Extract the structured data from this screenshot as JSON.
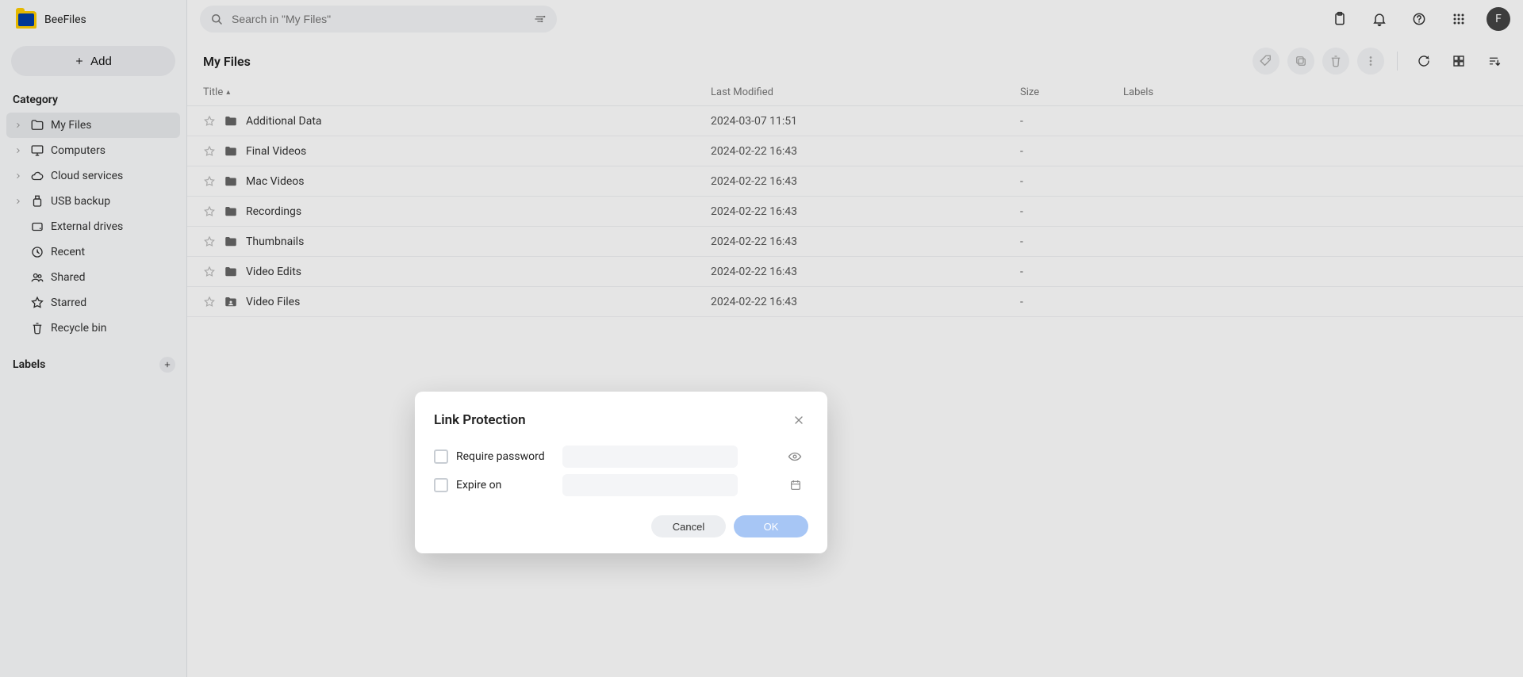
{
  "brand": {
    "name": "BeeFiles"
  },
  "sidebar": {
    "add_label": "Add",
    "category_title": "Category",
    "items": [
      {
        "label": "My Files",
        "icon": "folder-icon",
        "expandable": true,
        "active": true
      },
      {
        "label": "Computers",
        "icon": "monitor-icon",
        "expandable": true,
        "active": false
      },
      {
        "label": "Cloud services",
        "icon": "cloud-icon",
        "expandable": true,
        "active": false
      },
      {
        "label": "USB backup",
        "icon": "usb-icon",
        "expandable": true,
        "active": false
      },
      {
        "label": "External drives",
        "icon": "hdd-icon",
        "expandable": false,
        "active": false
      },
      {
        "label": "Recent",
        "icon": "clock-icon",
        "expandable": false,
        "active": false
      },
      {
        "label": "Shared",
        "icon": "people-icon",
        "expandable": false,
        "active": false
      },
      {
        "label": "Starred",
        "icon": "star-icon",
        "expandable": false,
        "active": false
      },
      {
        "label": "Recycle bin",
        "icon": "trash-icon",
        "expandable": false,
        "active": false
      }
    ],
    "labels_title": "Labels"
  },
  "search": {
    "placeholder": "Search in \"My Files\""
  },
  "avatar_initial": "F",
  "page_title": "My Files",
  "columns": {
    "title": "Title",
    "last_modified": "Last Modified",
    "size": "Size",
    "labels": "Labels"
  },
  "files": [
    {
      "name": "Additional Data",
      "modified": "2024-03-07 11:51",
      "size": "-",
      "icon": "folder"
    },
    {
      "name": "Final Videos",
      "modified": "2024-02-22 16:43",
      "size": "-",
      "icon": "folder"
    },
    {
      "name": "Mac Videos",
      "modified": "2024-02-22 16:43",
      "size": "-",
      "icon": "folder"
    },
    {
      "name": "Recordings",
      "modified": "2024-02-22 16:43",
      "size": "-",
      "icon": "folder"
    },
    {
      "name": "Thumbnails",
      "modified": "2024-02-22 16:43",
      "size": "-",
      "icon": "folder"
    },
    {
      "name": "Video Edits",
      "modified": "2024-02-22 16:43",
      "size": "-",
      "icon": "folder"
    },
    {
      "name": "Video Files",
      "modified": "2024-02-22 16:43",
      "size": "-",
      "icon": "folder-person"
    }
  ],
  "modal": {
    "title": "Link Protection",
    "require_password_label": "Require password",
    "expire_on_label": "Expire on",
    "cancel": "Cancel",
    "ok": "OK"
  }
}
